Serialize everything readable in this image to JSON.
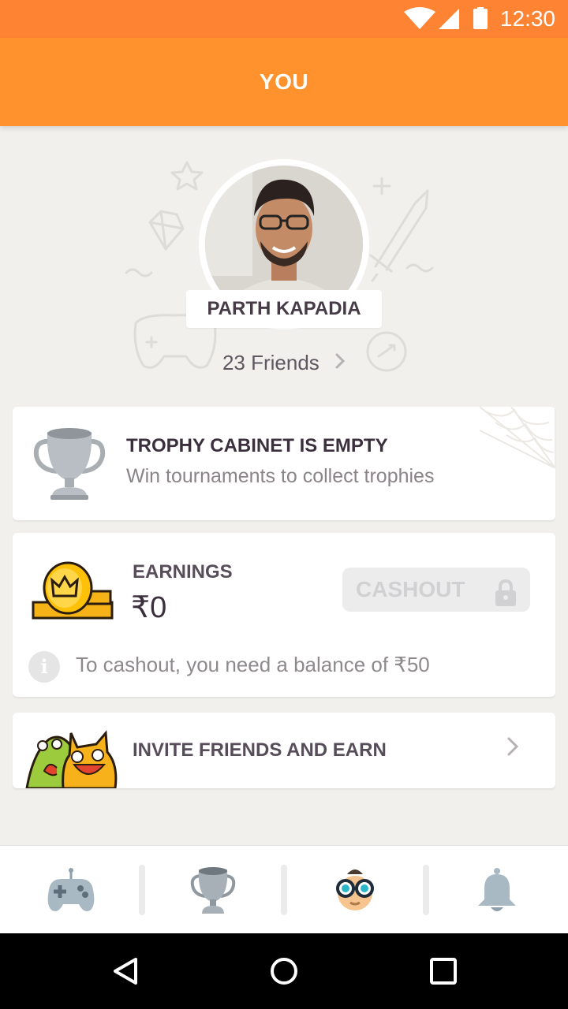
{
  "status_bar": {
    "time": "12:30"
  },
  "app_bar": {
    "title": "YOU"
  },
  "profile": {
    "name": "PARTH KAPADIA",
    "friends_label": "23 Friends"
  },
  "trophy_cabinet": {
    "title": "TROPHY CABINET IS EMPTY",
    "subtitle": "Win tournaments to collect trophies"
  },
  "earnings": {
    "label": "EARNINGS",
    "amount": "₹0",
    "cashout_label": "CASHOUT",
    "info_icon": "i",
    "note": "To cashout, you need a balance of ₹50"
  },
  "invite": {
    "label": "INVITE FRIENDS AND EARN"
  },
  "bottom_nav": {
    "items": [
      {
        "icon": "gamepad-icon"
      },
      {
        "icon": "trophy-icon"
      },
      {
        "icon": "profile-avatar-icon",
        "active": true
      },
      {
        "icon": "bell-icon"
      }
    ]
  },
  "colors": {
    "status_bar": "#fe8433",
    "app_bar": "#ff922c",
    "background": "#f1f0ec",
    "card": "#ffffff"
  }
}
